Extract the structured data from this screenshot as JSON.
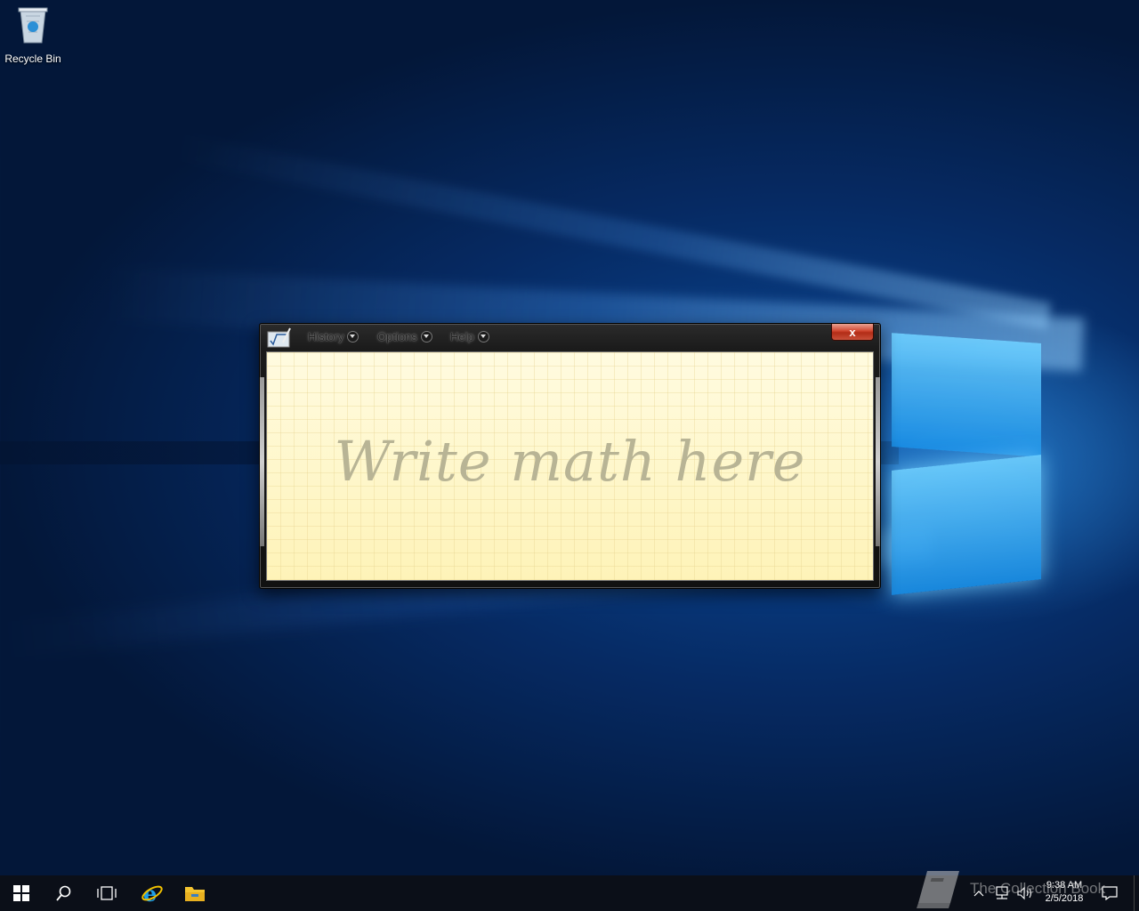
{
  "desktop": {
    "icons": [
      {
        "label": "Recycle Bin",
        "icon": "recycle-bin-icon"
      }
    ]
  },
  "math_input_window": {
    "menus": [
      {
        "label": "History",
        "icon": "chevron-down-icon"
      },
      {
        "label": "Options",
        "icon": "chevron-down-icon"
      },
      {
        "label": "Help",
        "icon": "chevron-down-icon"
      }
    ],
    "close_label": "x",
    "canvas_placeholder": "Write math here",
    "colors": {
      "canvas_bg": "#fef9d2",
      "close_red": "#c9503a",
      "frame": "#1a1a1a"
    }
  },
  "taskbar": {
    "buttons": [
      "start-icon",
      "search-icon",
      "task-view-icon",
      "internet-explorer-icon",
      "file-explorer-icon"
    ],
    "tray_icons": [
      "chevron-up-icon",
      "network-icon",
      "volume-icon",
      "action-center-icon"
    ],
    "clock": {
      "time": "9:38 AM",
      "date": "2/5/2018"
    }
  },
  "watermark": {
    "text": "The Collection Book"
  }
}
